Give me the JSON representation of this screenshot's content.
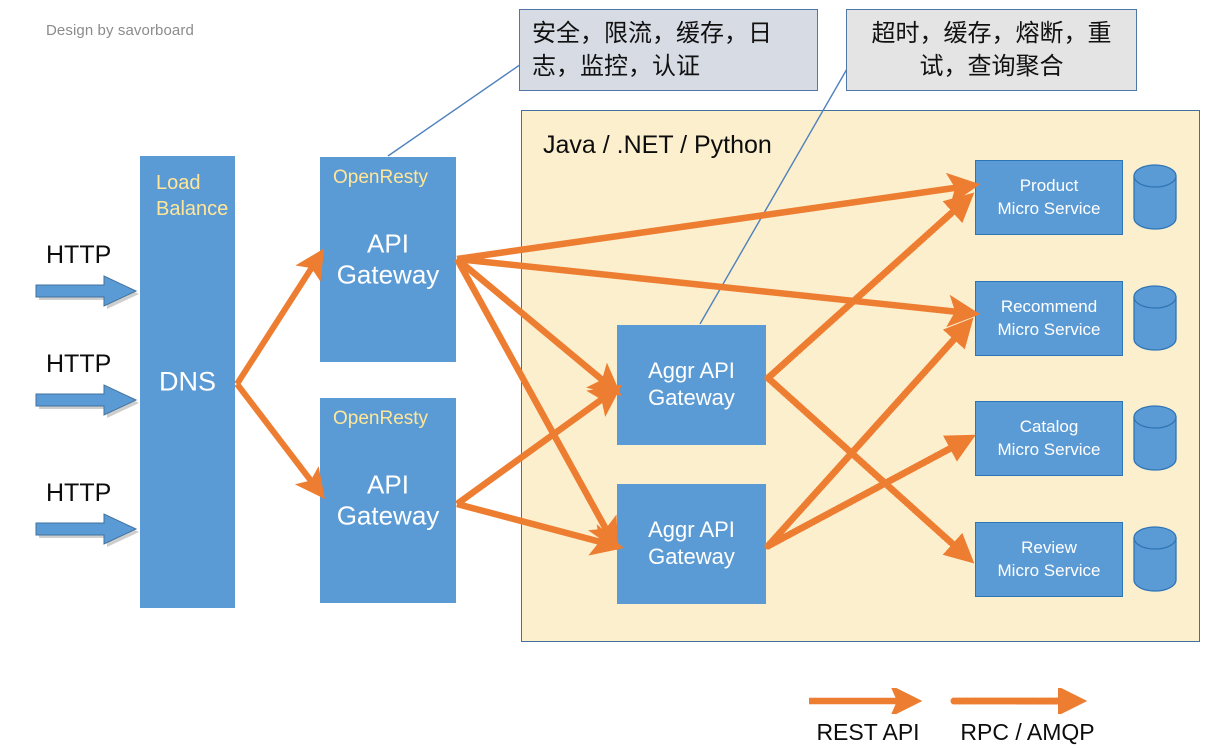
{
  "credit": "Design by savorboard",
  "colors": {
    "node_blue": "#5b9bd5",
    "node_blue_border": "#2e75b6",
    "panel_cream": "#fcefcd",
    "panel_border": "#41719c",
    "arrow_orange": "#ed7d31",
    "accent_gold": "#ffe699",
    "note_blue_bg": "#d7dce4",
    "note_gray_bg": "#e4e4e4",
    "note_border": "#4f77a8",
    "credit_gray": "#8b8b8b"
  },
  "notes": {
    "gateway": "安全，限流，缓存，日志，监控，认证",
    "aggr": "超时，缓存，熔断，重试，查询聚合"
  },
  "backend": {
    "platform_label": "Java / .NET / Python"
  },
  "load_balancer": {
    "sub_label": "Load Balance",
    "main_label": "DNS"
  },
  "http_requests": [
    {
      "label": "HTTP"
    },
    {
      "label": "HTTP"
    },
    {
      "label": "HTTP"
    }
  ],
  "gateways": [
    {
      "sub_label": "OpenResty",
      "main_label": "API Gateway"
    },
    {
      "sub_label": "OpenResty",
      "main_label": "API Gateway"
    }
  ],
  "aggr_gateways": [
    {
      "main_label": "Aggr API Gateway"
    },
    {
      "main_label": "Aggr API Gateway"
    }
  ],
  "microservices": [
    {
      "name": "Product",
      "kind": "Micro Service",
      "db": "database-cylinder"
    },
    {
      "name": "Recommend",
      "kind": "Micro Service",
      "db": "database-cylinder"
    },
    {
      "name": "Catalog",
      "kind": "Micro Service",
      "db": "database-cylinder"
    },
    {
      "name": "Review",
      "kind": "Micro Service",
      "db": "database-cylinder"
    }
  ],
  "legend": [
    {
      "label": "REST API",
      "style": "solid-arrow"
    },
    {
      "label": "RPC / AMQP",
      "style": "dotted-arrow"
    }
  ]
}
